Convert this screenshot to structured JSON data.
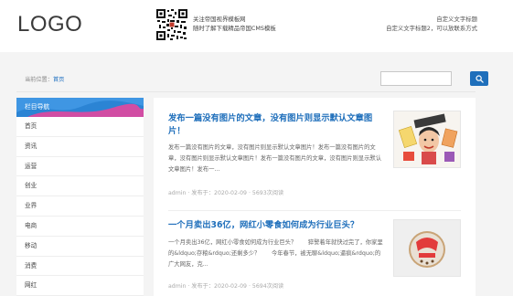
{
  "header": {
    "logo": "LOGO",
    "qr_line1": "关注帝国视界模板网",
    "qr_line2": "随时了解下载精品帝国CMS模板",
    "custom_line1": "自定义文字标题",
    "custom_line2": "自定义文字标题2，可以放联系方式"
  },
  "breadcrumb": {
    "prefix": "当前位置：",
    "home": "首页"
  },
  "search": {
    "placeholder": "",
    "icon": "search-icon"
  },
  "sidebar": {
    "heading": "栏目导航",
    "items": [
      "首页",
      "资讯",
      "运营",
      "创业",
      "业界",
      "电商",
      "移动",
      "消费",
      "网红"
    ]
  },
  "articles": [
    {
      "title": "发布一篇没有图片的文章，没有图片则显示默认文章图片！",
      "desc": "发布一篇没有图片的文章，没有图片则显示默认文章图片！发布一篇没有图片的文章，没有图片则显示默认文章图片！发布一篇没有图片的文章，没有图片则显示默认文章图片！发布一...",
      "meta": "admin · 发布于：2020-02-09 · 5693次阅读"
    },
    {
      "title": "一个月卖出36亿，网红小零食如何成为行业巨头？",
      "desc": "一个月卖出36亿，网红小零食如何成为行业巨头？　　猝警着年就快过完了，你家里的&ldquo;存粮&rdquo;还剩多少？　　今年春节，被无聊&ldquo;逼疯&rdquo;的广大网友，克...",
      "meta": "admin · 发布于：2020-02-09 · 5694次阅读"
    }
  ],
  "colors": {
    "accent": "#1f6fbb",
    "nav_head": "#2b84d4",
    "nav_wave": "#e8459c"
  }
}
